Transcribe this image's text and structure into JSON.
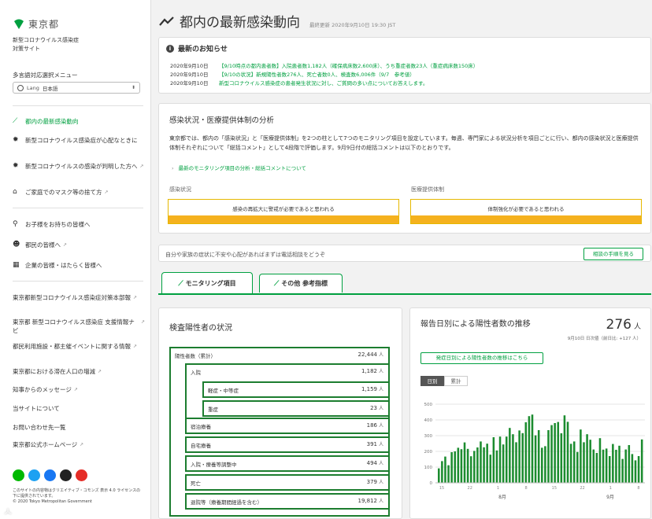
{
  "sidebar": {
    "logo": "東京都",
    "site_subtitle": "新型コロナウイルス感染症\n対策サイト",
    "lang_label": "多言語対応選択メニュー",
    "lang_prefix": "Lang",
    "lang_value": "日本語",
    "nav": [
      {
        "label": "都内の最新感染動向",
        "icon": "trend-icon"
      },
      {
        "label": "新型コロナウイルス感染症が心配なときに",
        "icon": "virus-icon"
      },
      {
        "label": "新型コロナウイルスの感染が判明した方へ",
        "icon": "virus-icon"
      },
      {
        "label": "ご家庭でのマスク等の捨て方",
        "icon": "trash-icon"
      },
      {
        "label": "お子様をお持ちの皆様へ",
        "icon": "parent-child-icon"
      },
      {
        "label": "都民の皆様へ",
        "icon": "people-icon"
      },
      {
        "label": "企業の皆様・はたらく皆様へ",
        "icon": "building-icon"
      },
      {
        "label": "東京都新型コロナウイルス感染症対策本部報"
      },
      {
        "label": "東京都 新型コロナウイルス感染症 支援情報ナビ"
      },
      {
        "label": "都民利用施設・都主催イベントに関する情報"
      },
      {
        "label": "東京都における滞在人口の増減"
      },
      {
        "label": "知事からのメッセージ"
      },
      {
        "label": "当サイトについて"
      },
      {
        "label": "お問い合わせ先一覧"
      },
      {
        "label": "東京都公式ホームページ"
      }
    ],
    "license": "このサイトの内容物はクリエイティブ・コモンズ 表示 4.0 ライセンスの下に提供されています。\n© 2020 Tokyo Metropolitan Government"
  },
  "header": {
    "title": "都内の最新感染動向",
    "updated": "最終更新 2020年9月10日 19:30 JST"
  },
  "news": {
    "title": "最新のお知らせ",
    "items": [
      {
        "date": "2020年9月10日",
        "text": "【9/10時点の都内患者数】入院患者数1,182人（確保病床数2,600床）、うち重症者数23人（重症病床数150床）"
      },
      {
        "date": "2020年9月10日",
        "text": "【9/10の状況】新規陽性者数276人、死亡者数0人、検査数6,006件（9/7　参考値）"
      },
      {
        "date": "2020年9月10日",
        "text": "新型コロナウイルス感染症の患者発生状況に対し、ご質問の多い点についてお答えします。"
      }
    ]
  },
  "analysis": {
    "title": "感染状況・医療提供体制の分析",
    "body": "東京都では、都内の「感染状況」と「医療提供体制」を2つの柱として7つのモニタリング項目を設定しています。毎週、専門家による状況分析を項目ごとに行い、都内の感染状況と医療提供体制それぞれについて「総括コメント」として4段階で評価します。9月9日付の総括コメントは以下のとおりです。",
    "link": "最新のモニタリング項目の分析・総括コメントについて",
    "infection_label": "感染状況",
    "infection_status": "感染の再拡大に警戒が必要であると思われる",
    "medical_label": "医療提供体制",
    "medical_status": "体制強化が必要であると思われる",
    "status_color": "#f5b11e"
  },
  "consult": {
    "text": "自分や家族の症状に不安や心配があればまずは電話相談をどうぞ",
    "button": "相談の手順を見る"
  },
  "tabs": [
    {
      "label": "モニタリング項目",
      "active": true
    },
    {
      "label": "その他 参考指標",
      "active": false
    }
  ],
  "positive_status": {
    "title": "検査陽性者の状況",
    "unit": "人",
    "rows": [
      {
        "label": "陽性者数（累計）",
        "value": "22,444"
      },
      {
        "label": "入院",
        "value": "1,182"
      },
      {
        "label": "軽症・中等症",
        "value": "1,159"
      },
      {
        "label": "重症",
        "value": "23"
      },
      {
        "label": "宿泊療養",
        "value": "186"
      },
      {
        "label": "自宅療養",
        "value": "391"
      },
      {
        "label": "入院・療養等調整中",
        "value": "494"
      },
      {
        "label": "死亡",
        "value": "379"
      },
      {
        "label": "退院等（療養期間経過を含む）",
        "value": "19,812"
      }
    ]
  },
  "daily_chart": {
    "title": "報告日別による陽性者数の推移",
    "latest_value": "276",
    "latest_unit": "人",
    "latest_note": "9月10日 日次値（前日比: +127 人）",
    "link": "発症日別による陽性者数の推移はこちら",
    "toggle_daily": "日別",
    "toggle_cumulative": "累計",
    "bar_color": "#1c8c2f"
  },
  "chart_data": {
    "type": "bar",
    "title": "報告日別による陽性者数の推移",
    "ylim": [
      0,
      500
    ],
    "yticks": [
      "0",
      "100",
      "200",
      "300",
      "400",
      "500"
    ],
    "xticks": [
      "15",
      "22",
      "1",
      "8",
      "15",
      "22",
      "1",
      "8"
    ],
    "month_labels": [
      "8月",
      "9月"
    ],
    "grid": true,
    "values": [
      92,
      138,
      167,
      112,
      195,
      200,
      223,
      214,
      257,
      216,
      169,
      203,
      225,
      263,
      226,
      249,
      179,
      290,
      206,
      294,
      244,
      294,
      349,
      309,
      258,
      333,
      316,
      385,
      424,
      434,
      302,
      335,
      223,
      233,
      335,
      367,
      380,
      387,
      315,
      429,
      388,
      248,
      263,
      196,
      339,
      258,
      309,
      274,
      212,
      190,
      284,
      211,
      218,
      170,
      247,
      210,
      236,
      152,
      212,
      240,
      183,
      143,
      170,
      276
    ]
  }
}
